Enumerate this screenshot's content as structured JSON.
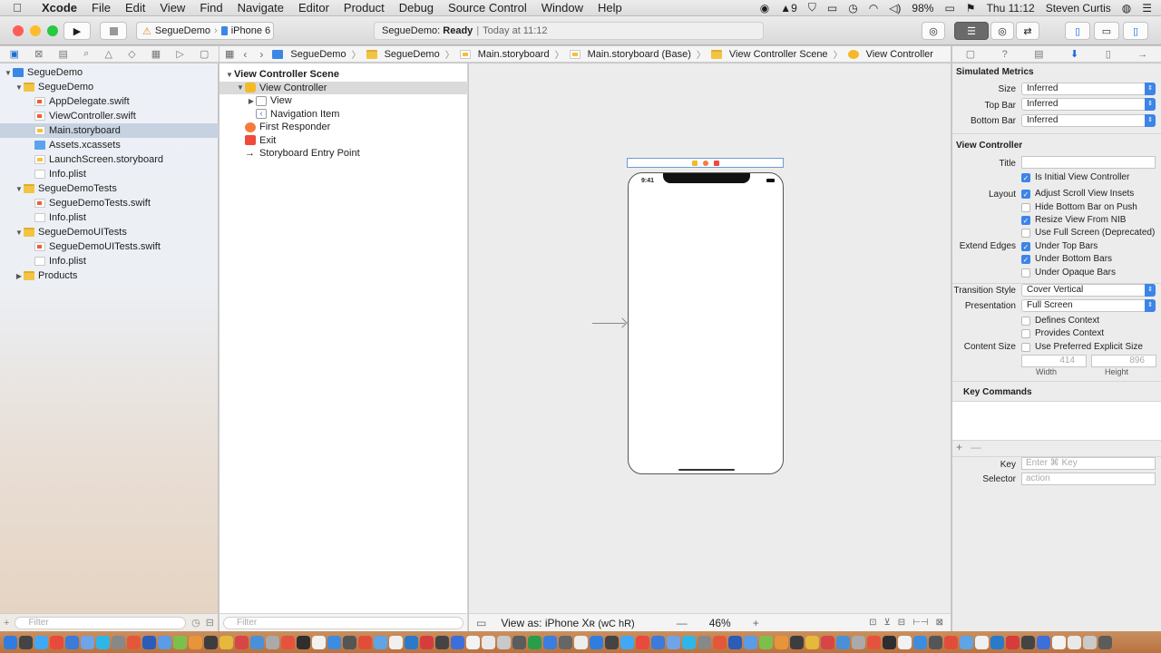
{
  "menubar": {
    "app": "Xcode",
    "items": [
      "File",
      "Edit",
      "View",
      "Find",
      "Navigate",
      "Editor",
      "Product",
      "Debug",
      "Source Control",
      "Window",
      "Help"
    ],
    "status_battery": "98%",
    "status_number": "9",
    "clock": "Thu 11:12",
    "user": "Steven Curtis"
  },
  "toolbar": {
    "scheme": "SegueDemo",
    "device": "iPhone 6",
    "status_project": "SegueDemo:",
    "status_state": "Ready",
    "status_time": "Today at 11:12"
  },
  "navigator": {
    "filter_placeholder": "Filter",
    "rows": [
      {
        "label": "SegueDemo",
        "icon": "project",
        "level": 0,
        "open": true
      },
      {
        "label": "SegueDemo",
        "icon": "folder",
        "level": 1,
        "open": true
      },
      {
        "label": "AppDelegate.swift",
        "icon": "swift",
        "level": 2
      },
      {
        "label": "ViewController.swift",
        "icon": "swift",
        "level": 2
      },
      {
        "label": "Main.storyboard",
        "icon": "storyboard",
        "level": 2,
        "selected": true
      },
      {
        "label": "Assets.xcassets",
        "icon": "assets",
        "level": 2
      },
      {
        "label": "LaunchScreen.storyboard",
        "icon": "storyboard",
        "level": 2
      },
      {
        "label": "Info.plist",
        "icon": "plist",
        "level": 2
      },
      {
        "label": "SegueDemoTests",
        "icon": "folder",
        "level": 1,
        "open": true
      },
      {
        "label": "SegueDemoTests.swift",
        "icon": "swift",
        "level": 2
      },
      {
        "label": "Info.plist",
        "icon": "plist",
        "level": 2
      },
      {
        "label": "SegueDemoUITests",
        "icon": "folder",
        "level": 1,
        "open": true
      },
      {
        "label": "SegueDemoUITests.swift",
        "icon": "swift",
        "level": 2
      },
      {
        "label": "Info.plist",
        "icon": "plist",
        "level": 2
      },
      {
        "label": "Products",
        "icon": "folder",
        "level": 1,
        "open": false
      }
    ]
  },
  "jumpbar": [
    "SegueDemo",
    "SegueDemo",
    "Main.storyboard",
    "Main.storyboard (Base)",
    "View Controller Scene",
    "View Controller"
  ],
  "outline": {
    "filter_placeholder": "Filter",
    "rows": [
      {
        "label": "View Controller Scene",
        "level": 0,
        "bold": true,
        "open": true
      },
      {
        "label": "View Controller",
        "level": 1,
        "selected": true,
        "open": true
      },
      {
        "label": "View",
        "level": 2,
        "open": false
      },
      {
        "label": "Navigation Item",
        "level": 2
      },
      {
        "label": "First Responder",
        "level": 1
      },
      {
        "label": "Exit",
        "level": 1
      },
      {
        "label": "Storyboard Entry Point",
        "level": 1
      }
    ]
  },
  "canvas": {
    "status_time": "9:41",
    "view_as_prefix": "View as: iPhone Xʀ",
    "view_as_suffix": "(wC hR)",
    "zoom_minus": "—",
    "zoom": "46%",
    "zoom_plus": "+"
  },
  "inspector": {
    "simulated_metrics": "Simulated Metrics",
    "size_label": "Size",
    "size_value": "Inferred",
    "topbar_label": "Top Bar",
    "topbar_value": "Inferred",
    "bottombar_label": "Bottom Bar",
    "bottombar_value": "Inferred",
    "view_controller": "View Controller",
    "title_label": "Title",
    "initial_vc": "Is Initial View Controller",
    "layout_label": "Layout",
    "adjust_scroll": "Adjust Scroll View Insets",
    "hide_bottom": "Hide Bottom Bar on Push",
    "resize_nib": "Resize View From NIB",
    "full_screen": "Use Full Screen (Deprecated)",
    "extend_label": "Extend Edges",
    "under_top": "Under Top Bars",
    "under_bottom": "Under Bottom Bars",
    "under_opaque": "Under Opaque Bars",
    "transition_label": "Transition Style",
    "transition_value": "Cover Vertical",
    "presentation_label": "Presentation",
    "presentation_value": "Full Screen",
    "defines_context": "Defines Context",
    "provides_context": "Provides Context",
    "content_size_label": "Content Size",
    "preferred_size": "Use Preferred Explicit Size",
    "width_value": "414",
    "height_value": "896",
    "width_label": "Width",
    "height_label": "Height",
    "key_commands": "Key Commands",
    "key_label": "Key",
    "key_placeholder": "Enter ⌘ Key",
    "selector_label": "Selector",
    "selector_placeholder": "action"
  },
  "colors": {
    "accent": "#3d84e8",
    "selection": "#c7d2e1",
    "dock": "#c08050"
  }
}
